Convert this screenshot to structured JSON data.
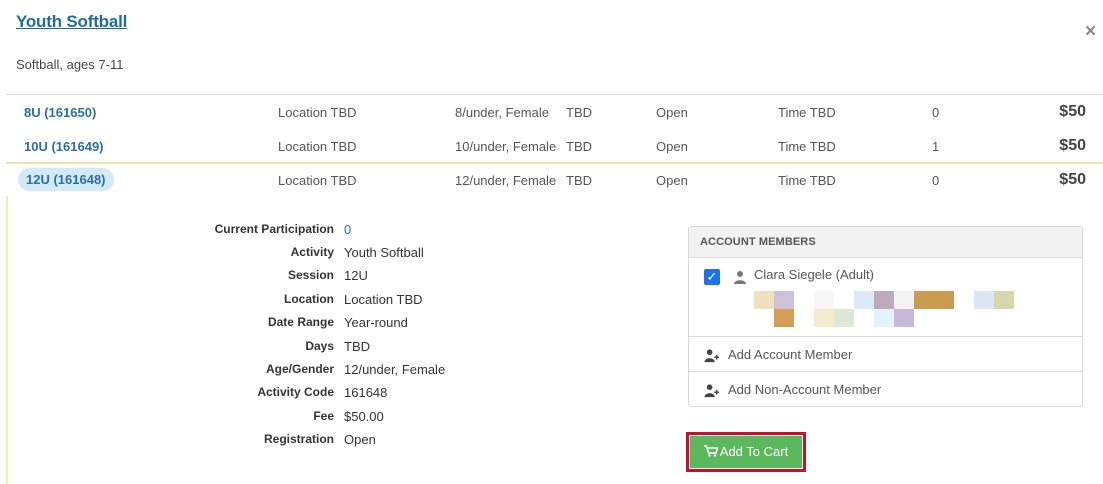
{
  "page": {
    "title": "Youth Softball",
    "subtitle": "Softball, ages 7-11",
    "close_label": "×"
  },
  "sessions": [
    {
      "code": "8U (161650)",
      "location": "Location TBD",
      "age_gender": "8/under, Female",
      "tbd": "TBD",
      "status": "Open",
      "time": "Time TBD",
      "count": "0",
      "price": "$50"
    },
    {
      "code": "10U (161649)",
      "location": "Location TBD",
      "age_gender": "10/under, Female",
      "tbd": "TBD",
      "status": "Open",
      "time": "Time TBD",
      "count": "1",
      "price": "$50"
    },
    {
      "code": "12U (161648)",
      "location": "Location TBD",
      "age_gender": "12/under, Female",
      "tbd": "TBD",
      "status": "Open",
      "time": "Time TBD",
      "count": "0",
      "price": "$50"
    }
  ],
  "details": [
    {
      "label": "Current Participation",
      "value": "0"
    },
    {
      "label": "Activity",
      "value": "Youth Softball"
    },
    {
      "label": "Session",
      "value": "12U"
    },
    {
      "label": "Location",
      "value": "Location TBD"
    },
    {
      "label": "Date Range",
      "value": "Year-round"
    },
    {
      "label": "Days",
      "value": "TBD"
    },
    {
      "label": "Age/Gender",
      "value": "12/under, Female"
    },
    {
      "label": "Activity Code",
      "value": "161648"
    },
    {
      "label": "Fee",
      "value": "$50.00"
    },
    {
      "label": "Registration",
      "value": "Open"
    }
  ],
  "members": {
    "header": "ACCOUNT MEMBERS",
    "member_name": "Clara Siegele (Adult)",
    "add_account": "Add Account Member",
    "add_non_account": "Add Non-Account Member"
  },
  "cart": {
    "label": "Add To Cart"
  },
  "colors": {
    "accent_blue": "#2a6f9f",
    "cart_green": "#5cb85c",
    "highlight_red": "#c8102e"
  }
}
